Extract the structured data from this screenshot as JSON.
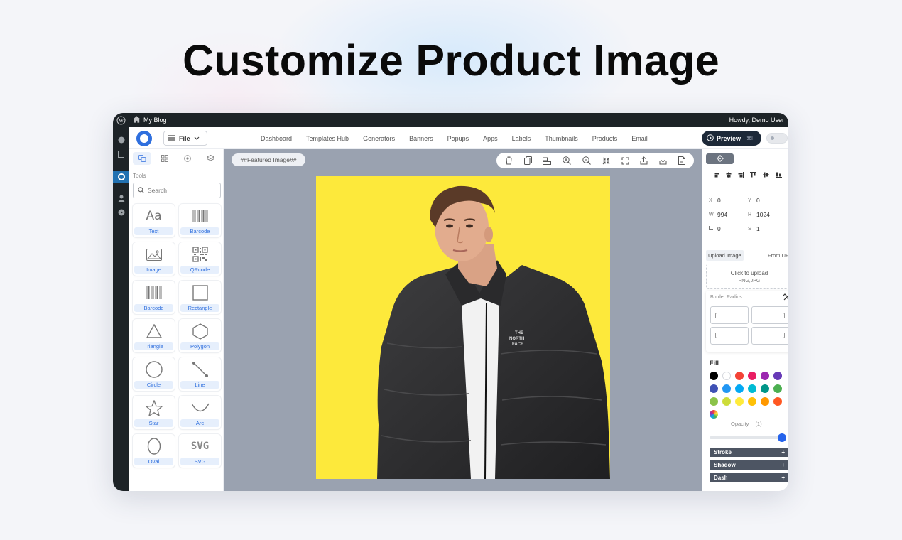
{
  "headline": "Customize Product Image",
  "wp_bar": {
    "site_name": "My Blog",
    "greeting": "Howdy, Demo User"
  },
  "topbar": {
    "file_label": "File",
    "nav": [
      "Dashboard",
      "Templates Hub",
      "Generators",
      "Banners",
      "Popups",
      "Apps",
      "Labels",
      "Thumbnails",
      "Products",
      "Email"
    ],
    "preview_label": "Preview",
    "preview_shortcut": "⌘I"
  },
  "left_panel": {
    "tools_label": "Tools",
    "search_placeholder": "Search",
    "tools": [
      {
        "label": "Text",
        "icon": "text-icon"
      },
      {
        "label": "Barcode",
        "icon": "barcode-icon"
      },
      {
        "label": "Image",
        "icon": "image-icon"
      },
      {
        "label": "QRcode",
        "icon": "qrcode-icon"
      },
      {
        "label": "Barcode",
        "icon": "barcode-icon"
      },
      {
        "label": "Rectangle",
        "icon": "rectangle-icon"
      },
      {
        "label": "Triangle",
        "icon": "triangle-icon"
      },
      {
        "label": "Polygon",
        "icon": "polygon-icon"
      },
      {
        "label": "Circle",
        "icon": "circle-icon"
      },
      {
        "label": "Line",
        "icon": "line-icon"
      },
      {
        "label": "Star",
        "icon": "star-icon"
      },
      {
        "label": "Arc",
        "icon": "arc-icon"
      },
      {
        "label": "Oval",
        "icon": "oval-icon"
      },
      {
        "label": "SVG",
        "icon": "svg-icon"
      }
    ]
  },
  "canvas": {
    "element_label": "##Featured Image##",
    "background_color": "#fde93b"
  },
  "right_panel": {
    "fields": {
      "x": "0",
      "y": "0",
      "w": "994",
      "h": "1024",
      "angle": "0",
      "s": "1"
    },
    "field_keys": {
      "x": "X",
      "y": "Y",
      "w": "W",
      "h": "H",
      "s": "S"
    },
    "upload_tab": "Upload Image",
    "url_tab": "From URL",
    "upload_title": "Click to upload",
    "upload_formats": "PNG,JPG",
    "border_radius_label": "Border Radius",
    "fill_label": "Fill",
    "fill_colors": [
      "#000000",
      "#ffffff",
      "#f44336",
      "#e91e63",
      "#9c27b0",
      "#673ab7",
      "#3f51b5",
      "#2196f3",
      "#03a9f4",
      "#00bcd4",
      "#009688",
      "#4caf50",
      "#8bc34a",
      "#cddc39",
      "#ffeb3b",
      "#ffc107",
      "#ff9800",
      "#ff5722"
    ],
    "opacity_label": "Opacity",
    "opacity_value": "(1)",
    "opacity_level": 1,
    "sections": [
      "Stroke",
      "Shadow",
      "Dash"
    ]
  }
}
